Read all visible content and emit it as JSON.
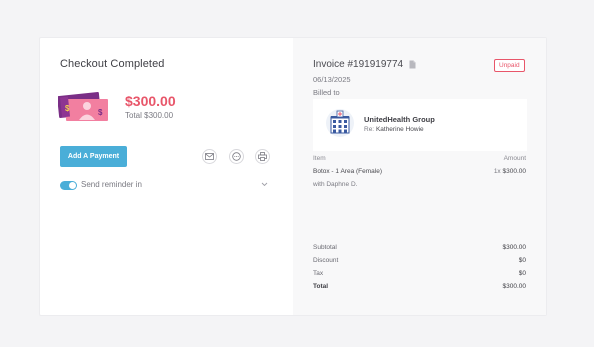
{
  "checkout": {
    "title": "Checkout Completed",
    "amount": "$300.00",
    "total_line": "Total $300.00",
    "add_payment_label": "Add A Payment",
    "actions": [
      {
        "icon": "mail-icon"
      },
      {
        "icon": "chat-bubble-icon"
      },
      {
        "icon": "printer-icon"
      }
    ],
    "reminder": {
      "label": "Send reminder in",
      "enabled": true
    }
  },
  "invoice": {
    "title": "Invoice #191919774",
    "status": "Unpaid",
    "date": "06/13/2025",
    "billed_to_label": "Billed to",
    "payer": {
      "name": "UnitedHealth Group",
      "re_label": "Re:",
      "patient": "Katherine Howie"
    },
    "columns": {
      "item": "Item",
      "amount": "Amount"
    },
    "line_items": [
      {
        "name": "Botox - 1 Area (Female)",
        "provider": "with Daphne D.",
        "qty": "1x",
        "amount": "$300.00"
      }
    ],
    "totals": {
      "subtotal_label": "Subtotal",
      "subtotal": "$300.00",
      "discount_label": "Discount",
      "discount": "$0",
      "tax_label": "Tax",
      "tax": "$0",
      "total_label": "Total",
      "total": "$300.00"
    }
  },
  "colors": {
    "accent": "#4aaed8",
    "amount": "#e8566a",
    "unpaid": "#e8566a",
    "money_pink": "#f27fa0",
    "money_purple": "#7a2e86"
  }
}
